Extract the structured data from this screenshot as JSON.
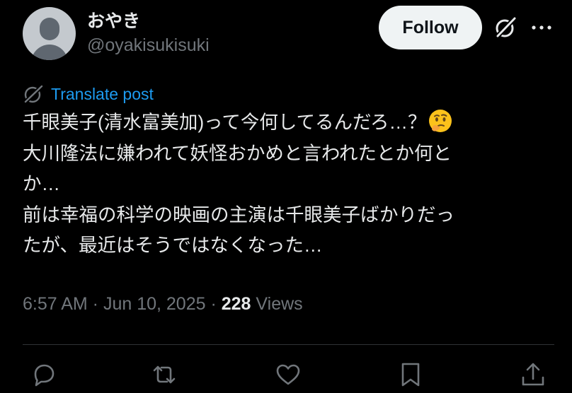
{
  "author": {
    "display_name": "おやき",
    "handle": "@oyakisukisuki",
    "avatar_icon": "default-avatar-icon"
  },
  "header": {
    "follow_label": "Follow",
    "grok_icon": "grok-icon",
    "more_icon": "more-options-icon"
  },
  "translate": {
    "label": "Translate post",
    "icon": "translate-globe-icon",
    "color": "#1d9bf0"
  },
  "tweet": {
    "lines": [
      "千眼美子(清水富美加)って今何してるんだろ…？",
      "大川隆法に嫌われて妖怪おかめと言われたとか何と",
      "か…",
      "前は幸福の科学の映画の主演は千眼美子ばかりだっ",
      "たが、最近はそうではなくなった…"
    ],
    "emoji": "thinking-face-emoji"
  },
  "meta": {
    "time": "6:57 AM",
    "separator": " · ",
    "date": "Jun 10, 2025",
    "views_count": "228",
    "views_label": "Views"
  },
  "actions": [
    {
      "name": "reply",
      "icon": "reply-icon"
    },
    {
      "name": "repost",
      "icon": "repost-icon"
    },
    {
      "name": "like",
      "icon": "like-icon"
    },
    {
      "name": "bookmark",
      "icon": "bookmark-icon"
    },
    {
      "name": "share",
      "icon": "share-icon"
    }
  ],
  "colors": {
    "background": "#000000",
    "text": "#e7e9ea",
    "muted": "#71767b",
    "accent": "#1d9bf0",
    "follow_bg": "#eff3f4"
  }
}
